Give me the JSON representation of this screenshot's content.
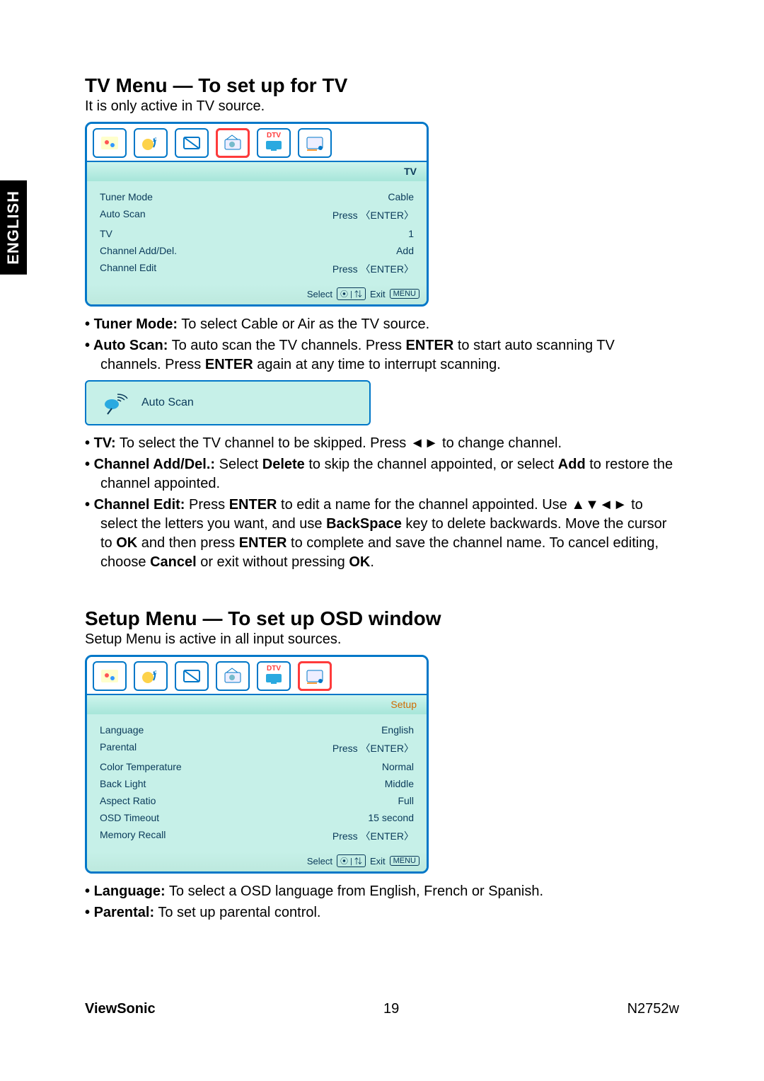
{
  "side_tab": "ENGLISH",
  "section1": {
    "heading": "TV Menu — To set up for TV",
    "intro": "It is only active in TV source.",
    "osd_label": "TV",
    "menu": {
      "tuner_mode": {
        "label": "Tuner Mode",
        "value": "Cable"
      },
      "auto_scan": {
        "label": "Auto Scan",
        "value": "Press 〈ENTER〉"
      },
      "tv": {
        "label": "TV",
        "value": "1"
      },
      "channel_add_del": {
        "label": "Channel Add/Del.",
        "value": "Add"
      },
      "channel_edit": {
        "label": "Channel Edit",
        "value": "Press 〈ENTER〉"
      }
    },
    "footer_select": "Select",
    "footer_exit": "Exit",
    "footer_menu": "MENU",
    "bullets": {
      "b1_strong": "Tuner Mode:",
      "b1_text": " To select Cable or Air as the TV source.",
      "b2_strong": "Auto Scan:",
      "b2_text_a": " To auto scan the TV channels. Press ",
      "b2_enter1": "ENTER",
      "b2_text_b": " to start auto scanning TV channels. Press ",
      "b2_enter2": "ENTER",
      "b2_text_c": " again at any time to interrupt scanning.",
      "autoscan_box": "Auto Scan",
      "b3_strong": "TV:",
      "b3_text": " To select the TV channel to be skipped. Press ◄► to change channel.",
      "b4_strong": "Channel Add/Del.:",
      "b4_text_a": " Select ",
      "b4_delete": "Delete",
      "b4_text_b": " to skip the channel appointed, or select ",
      "b4_add": "Add",
      "b4_text_c": " to restore the channel appointed.",
      "b5_strong": "Channel Edit:",
      "b5_text_a": " Press ",
      "b5_enter": "ENTER",
      "b5_text_b": " to edit a name for the channel appointed. Use ▲▼◄► to select the letters you want, and use ",
      "b5_backspace": "BackSpace",
      "b5_text_c": " key to delete backwards. Move the cursor to ",
      "b5_ok1": "OK",
      "b5_text_d": " and then press ",
      "b5_enter2": "ENTER",
      "b5_text_e": " to complete and save the channel name. To cancel editing, choose ",
      "b5_cancel": "Cancel",
      "b5_text_f": " or exit without pressing ",
      "b5_ok2": "OK",
      "b5_text_g": "."
    }
  },
  "section2": {
    "heading": "Setup Menu — To set up OSD window",
    "intro": "Setup Menu is active in all input sources.",
    "osd_label": "Setup",
    "menu": {
      "language": {
        "label": "Language",
        "value": "English"
      },
      "parental": {
        "label": "Parental",
        "value": "Press 〈ENTER〉"
      },
      "color_temp": {
        "label": "Color Temperature",
        "value": "Normal"
      },
      "back_light": {
        "label": "Back Light",
        "value": "Middle"
      },
      "aspect_ratio": {
        "label": "Aspect Ratio",
        "value": "Full"
      },
      "osd_timeout": {
        "label": "OSD Timeout",
        "value": "15 second"
      },
      "memory_recall": {
        "label": "Memory Recall",
        "value": "Press 〈ENTER〉"
      }
    },
    "footer_select": "Select",
    "footer_exit": "Exit",
    "footer_menu": "MENU",
    "bullets": {
      "b1_strong": "Language:",
      "b1_text": " To select a OSD language from English, French or Spanish.",
      "b2_strong": "Parental:",
      "b2_text": " To set up parental control."
    }
  },
  "footer": {
    "brand": "ViewSonic",
    "page": "19",
    "model": "N2752w"
  },
  "icons": {
    "tab_picture": "picture-icon",
    "tab_audio": "audio-icon",
    "tab_screen": "screen-icon",
    "tab_tv": "tv-icon",
    "tab_dtv": "dtv-icon",
    "tab_setup": "setup-icon"
  }
}
